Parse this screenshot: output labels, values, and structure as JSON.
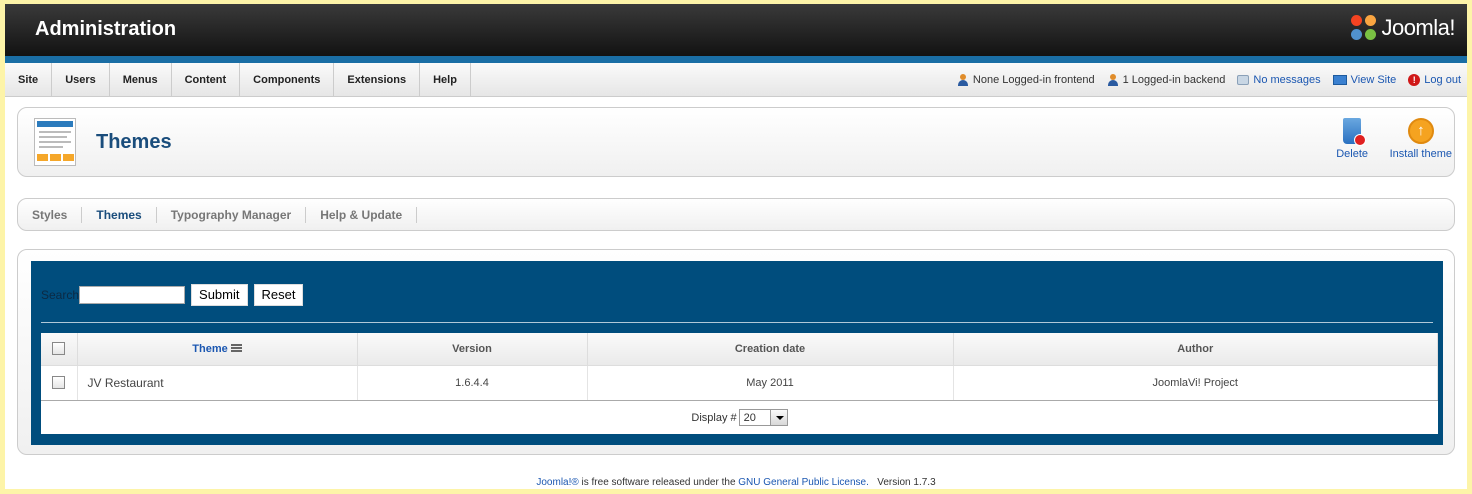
{
  "header": {
    "title": "Administration",
    "logo_text": "Joomla!"
  },
  "menu": {
    "items": [
      "Site",
      "Users",
      "Menus",
      "Content",
      "Components",
      "Extensions",
      "Help"
    ]
  },
  "status": {
    "frontend": "None Logged-in frontend",
    "backend": "1 Logged-in backend",
    "messages": "No messages",
    "view_site": "View Site",
    "logout": "Log out"
  },
  "toolbar": {
    "title": "Themes",
    "delete_label": "Delete",
    "install_label": "Install theme"
  },
  "tabs": [
    {
      "label": "Styles",
      "active": false
    },
    {
      "label": "Themes",
      "active": true
    },
    {
      "label": "Typography Manager",
      "active": false
    },
    {
      "label": "Help & Update",
      "active": false
    }
  ],
  "search": {
    "label": "Search",
    "value": "",
    "submit_label": "Submit",
    "reset_label": "Reset"
  },
  "table": {
    "columns": [
      "Theme",
      "Version",
      "Creation date",
      "Author"
    ],
    "rows": [
      {
        "theme": "JV Restaurant",
        "version": "1.6.4.4",
        "created": "May 2011",
        "author": "JoomlaVi! Project"
      }
    ]
  },
  "pagination": {
    "label": "Display #",
    "value": "20"
  },
  "footer": {
    "joomla_link": "Joomla!®",
    "text1": " is free software released under the ",
    "license_link": "GNU General Public License.",
    "version": "Version 1.7.3"
  },
  "colors": {
    "brand_blue": "#004d7d",
    "link": "#1b57b1",
    "background": "#fdf4a8"
  }
}
